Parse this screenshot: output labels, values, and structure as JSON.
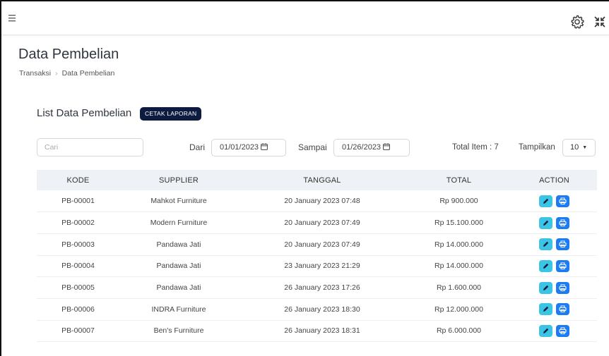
{
  "topbar": {
    "menu_icon": "hamburger-icon",
    "settings_icon": "gear-icon",
    "collapse_icon": "collapse-icon"
  },
  "page": {
    "title": "Data Pembelian",
    "breadcrumb": [
      "Transaksi",
      "Data Pembelian"
    ]
  },
  "list": {
    "title": "List Data Pembelian",
    "report_button": "CETAK LAPORAN"
  },
  "filters": {
    "search_placeholder": "Cari",
    "from_label": "Dari",
    "from_value": "01/01/2023",
    "to_label": "Sampai",
    "to_value": "01/26/2023",
    "total_label": "Total Item : 7",
    "show_label": "Tampilkan",
    "show_value": "10"
  },
  "table": {
    "columns": [
      "KODE",
      "SUPPLIER",
      "TANGGAL",
      "TOTAL",
      "ACTION"
    ],
    "rows": [
      {
        "kode": "PB-00001",
        "supplier": "Mahkot Furniture",
        "tanggal": "20 January 2023 07:48",
        "total": "Rp 900.000"
      },
      {
        "kode": "PB-00002",
        "supplier": "Modern Furniture",
        "tanggal": "20 January 2023 07:49",
        "total": "Rp 15.100.000"
      },
      {
        "kode": "PB-00003",
        "supplier": "Pandawa Jati",
        "tanggal": "20 January 2023 07:49",
        "total": "Rp 14.000.000"
      },
      {
        "kode": "PB-00004",
        "supplier": "Pandawa Jati",
        "tanggal": "23 January 2023 21:29",
        "total": "Rp 14.000.000"
      },
      {
        "kode": "PB-00005",
        "supplier": "Pandawa Jati",
        "tanggal": "26 January 2023 17:26",
        "total": "Rp 1.600.000"
      },
      {
        "kode": "PB-00006",
        "supplier": "INDRA Furniture",
        "tanggal": "26 January 2023 18:30",
        "total": "Rp 12.000.000"
      },
      {
        "kode": "PB-00007",
        "supplier": "Ben's Furniture",
        "tanggal": "26 January 2023 18:31",
        "total": "Rp 6.000.000"
      }
    ]
  },
  "colors": {
    "report_button": "#0d1b40",
    "edit_button": "#3bc4e6",
    "print_button": "#1e7cf2",
    "header_row": "#eef1f6"
  }
}
